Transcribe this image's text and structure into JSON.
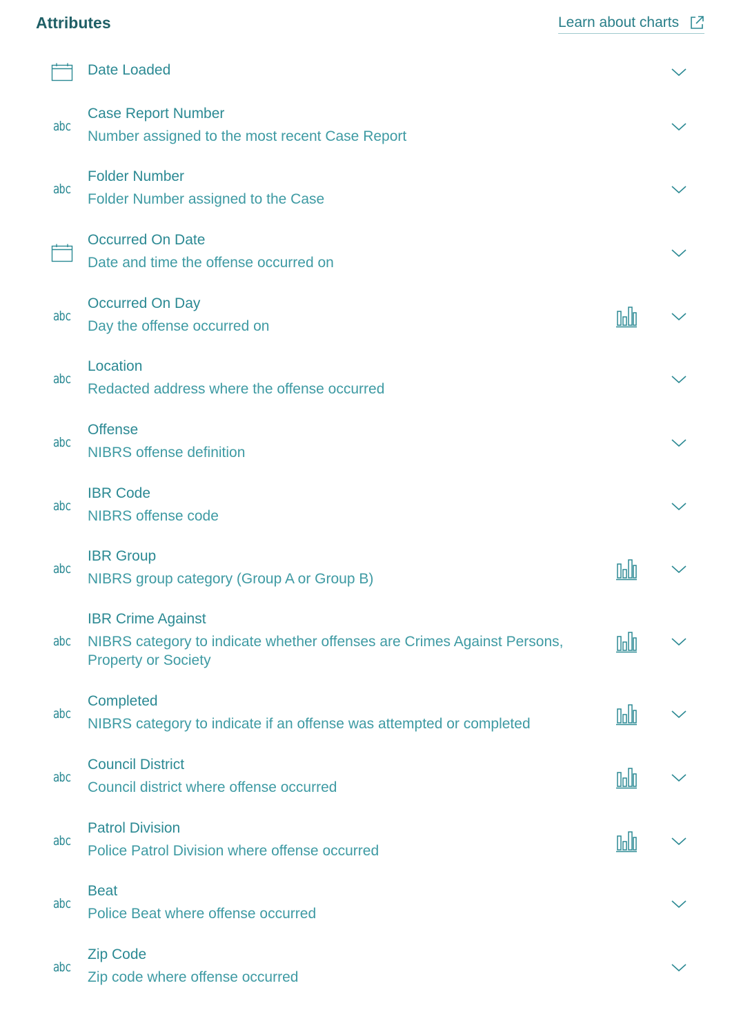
{
  "header": {
    "title": "Attributes",
    "learn_link": "Learn about charts",
    "learn_link_icon": "external-link-icon"
  },
  "colors": {
    "accent": "#2b8993",
    "heading": "#1f5f66"
  },
  "attributes": [
    {
      "name": "Date Loaded",
      "description": "",
      "type_icon": "calendar-icon",
      "has_chart": false
    },
    {
      "name": "Case Report Number",
      "description": "Number assigned to the most recent Case Report",
      "type_icon": "abc",
      "has_chart": false
    },
    {
      "name": "Folder Number",
      "description": "Folder Number assigned to the Case",
      "type_icon": "abc",
      "has_chart": false
    },
    {
      "name": "Occurred On Date",
      "description": "Date and time the offense occurred on",
      "type_icon": "calendar-icon",
      "has_chart": false
    },
    {
      "name": "Occurred On Day",
      "description": "Day the offense occurred on",
      "type_icon": "abc",
      "has_chart": true
    },
    {
      "name": "Location",
      "description": "Redacted address where the offense occurred",
      "type_icon": "abc",
      "has_chart": false
    },
    {
      "name": "Offense",
      "description": "NIBRS offense definition",
      "type_icon": "abc",
      "has_chart": false
    },
    {
      "name": "IBR Code",
      "description": "NIBRS offense code",
      "type_icon": "abc",
      "has_chart": false
    },
    {
      "name": "IBR Group",
      "description": "NIBRS group category (Group A or Group B)",
      "type_icon": "abc",
      "has_chart": true
    },
    {
      "name": "IBR Crime Against",
      "description": "NIBRS category to indicate whether offenses are Crimes Against Persons, Property or Society",
      "type_icon": "abc",
      "has_chart": true
    },
    {
      "name": "Completed",
      "description": "NIBRS category to indicate if an offense was attempted or completed",
      "type_icon": "abc",
      "has_chart": true
    },
    {
      "name": "Council District",
      "description": "Council district where offense occurred",
      "type_icon": "abc",
      "has_chart": true
    },
    {
      "name": "Patrol Division",
      "description": "Police Patrol Division where offense occurred",
      "type_icon": "abc",
      "has_chart": true
    },
    {
      "name": "Beat",
      "description": "Police Beat where offense occurred",
      "type_icon": "abc",
      "has_chart": false
    },
    {
      "name": "Zip Code",
      "description": "Zip code where offense occurred",
      "type_icon": "abc",
      "has_chart": false
    }
  ]
}
